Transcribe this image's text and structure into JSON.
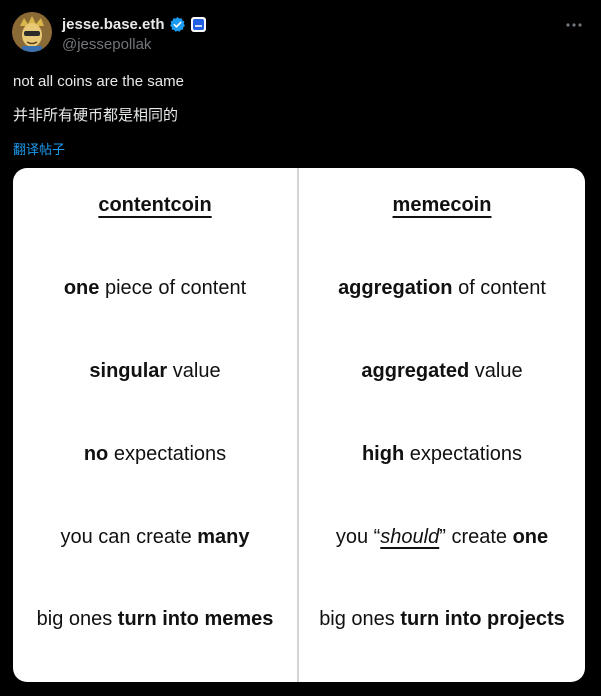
{
  "author": {
    "display_name": "jesse.base.eth",
    "handle": "@jessepollak",
    "avatar": "avatar",
    "badges": [
      "verified-icon",
      "affiliation-icon"
    ],
    "verified_color": "#1d9bf0"
  },
  "tweet": {
    "text_en": "not all coins are the same",
    "text_zh": "并非所有硬币都是相同的",
    "translate_label": "翻译帖子"
  },
  "comparison": {
    "left": {
      "heading": "contentcoin",
      "rows": [
        {
          "pre": "",
          "bold": "one",
          "post": " piece of content"
        },
        {
          "pre": "",
          "bold": "singular",
          "post": " value"
        },
        {
          "pre": "",
          "bold": "no",
          "post": " expectations"
        },
        {
          "pre": "you can create ",
          "bold": "many",
          "post": ""
        },
        {
          "pre": "big ones ",
          "bold": "turn into memes",
          "post": ""
        }
      ]
    },
    "right": {
      "heading": "memecoin",
      "rows": [
        {
          "pre": "",
          "bold": "aggregation",
          "post": " of content"
        },
        {
          "pre": "",
          "bold": "aggregated",
          "post": " value"
        },
        {
          "pre": "",
          "bold": "high",
          "post": " expectations"
        },
        {
          "pre": "you “",
          "italic": "should",
          "mid": "” create ",
          "bold": "one",
          "post": ""
        },
        {
          "pre": "big ones ",
          "bold": "turn into projects",
          "post": ""
        }
      ]
    }
  },
  "colors": {
    "background": "#000000",
    "text": "#e7e9ea",
    "muted": "#71767b",
    "link": "#1d9bf0",
    "card": "#ffffff"
  }
}
